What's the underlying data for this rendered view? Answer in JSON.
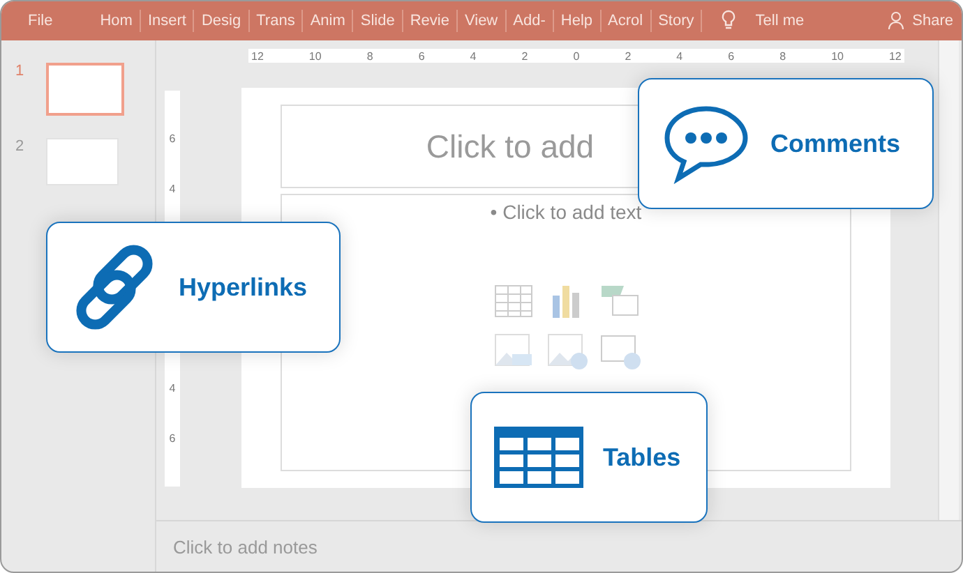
{
  "ribbon": {
    "tabs": [
      {
        "label": "File"
      },
      {
        "label": "Hom"
      },
      {
        "label": "Insert"
      },
      {
        "label": "Desig"
      },
      {
        "label": "Trans"
      },
      {
        "label": "Anim"
      },
      {
        "label": "Slide"
      },
      {
        "label": "Revie"
      },
      {
        "label": "View"
      },
      {
        "label": "Add-"
      },
      {
        "label": "Help"
      },
      {
        "label": "Acrol"
      },
      {
        "label": "Story"
      }
    ],
    "tell_me": "Tell me",
    "share": "Share"
  },
  "slides": [
    {
      "number": "1",
      "selected": true
    },
    {
      "number": "2",
      "selected": false
    }
  ],
  "ruler": {
    "horizontal": [
      "12",
      "10",
      "8",
      "6",
      "4",
      "2",
      "0",
      "2",
      "4",
      "6",
      "8",
      "10",
      "12"
    ],
    "vertical": [
      "6",
      "4",
      "4",
      "6"
    ]
  },
  "slide": {
    "title_placeholder": "Click to add",
    "body_placeholder": "• Click to add text"
  },
  "notes": {
    "placeholder": "Click to add notes"
  },
  "callouts": [
    {
      "kind": "comments",
      "label": "Comments"
    },
    {
      "kind": "hyperlinks",
      "label": "Hyperlinks"
    },
    {
      "kind": "tables",
      "label": "Tables"
    }
  ]
}
